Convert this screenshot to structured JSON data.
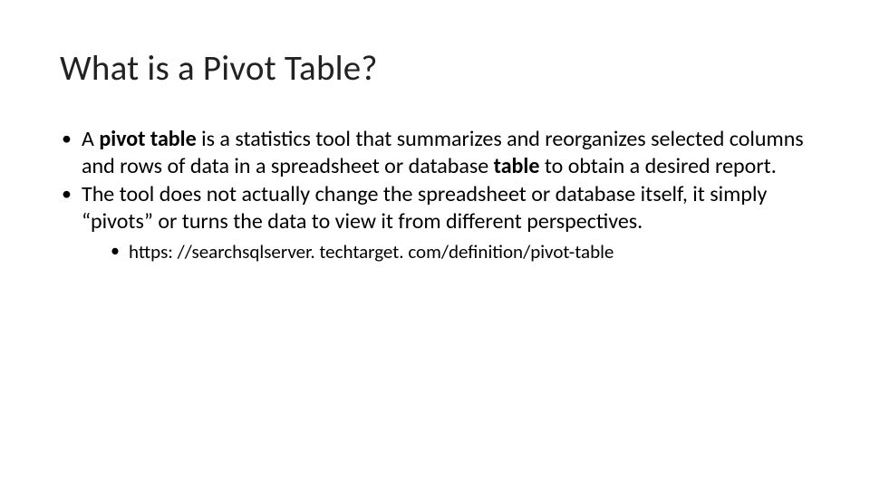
{
  "title": "What is a Pivot Table?",
  "bullets": {
    "b1_pre": "A ",
    "b1_bold1": "pivot table",
    "b1_mid": " is a statistics tool that summarizes and reorganizes selected columns and rows of data in a spreadsheet or database ",
    "b1_bold2": "table",
    "b1_post": " to obtain a desired report.",
    "b2": "The tool does not actually change the spreadsheet or database itself, it simply “pivots” or turns the data to view it from different perspectives.",
    "sub1": "https: //searchsqlserver. techtarget. com/definition/pivot-table"
  }
}
